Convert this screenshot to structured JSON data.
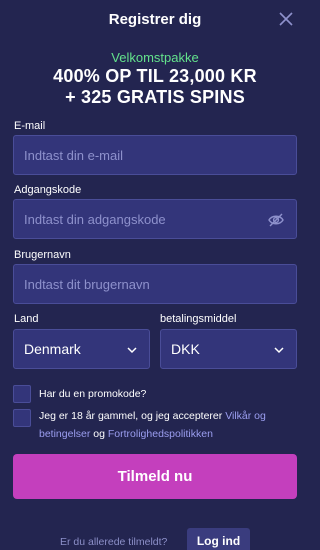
{
  "header": {
    "title": "Registrer dig",
    "close_icon": "close-icon"
  },
  "promo": {
    "subtitle": "Velkomstpakke",
    "line1": "400% OP TIL 23,000 KR",
    "line2": "+ 325 GRATIS SPINS",
    "accent_color": "#63e28c"
  },
  "form": {
    "email": {
      "label": "E-mail",
      "placeholder": "Indtast din e-mail"
    },
    "password": {
      "label": "Adgangskode",
      "placeholder": "Indtast din adgangskode",
      "icon": "eye-off-icon"
    },
    "username": {
      "label": "Brugernavn",
      "placeholder": "Indtast dit brugernavn"
    },
    "country": {
      "label": "Land",
      "value": "Denmark"
    },
    "currency": {
      "label": "betalingsmiddel",
      "value": "DKK"
    },
    "promo_checkbox": {
      "label": "Har du en promokode?"
    },
    "terms_checkbox": {
      "text_before": "Jeg er 18 år gammel, og jeg accepterer ",
      "terms_link_1": "Vilkår og",
      "terms_link_2": "betingelser",
      "text_and": " og ",
      "privacy_link": "Fortrolighedspolitikken"
    },
    "submit_label": "Tilmeld nu",
    "submit_color": "#c43fbd"
  },
  "footer": {
    "text": "Er du allerede tilmeldt?",
    "login_label": "Log ind"
  },
  "colors": {
    "background": "#232550",
    "input_bg": "#33357a",
    "link": "#9b9ef0"
  }
}
